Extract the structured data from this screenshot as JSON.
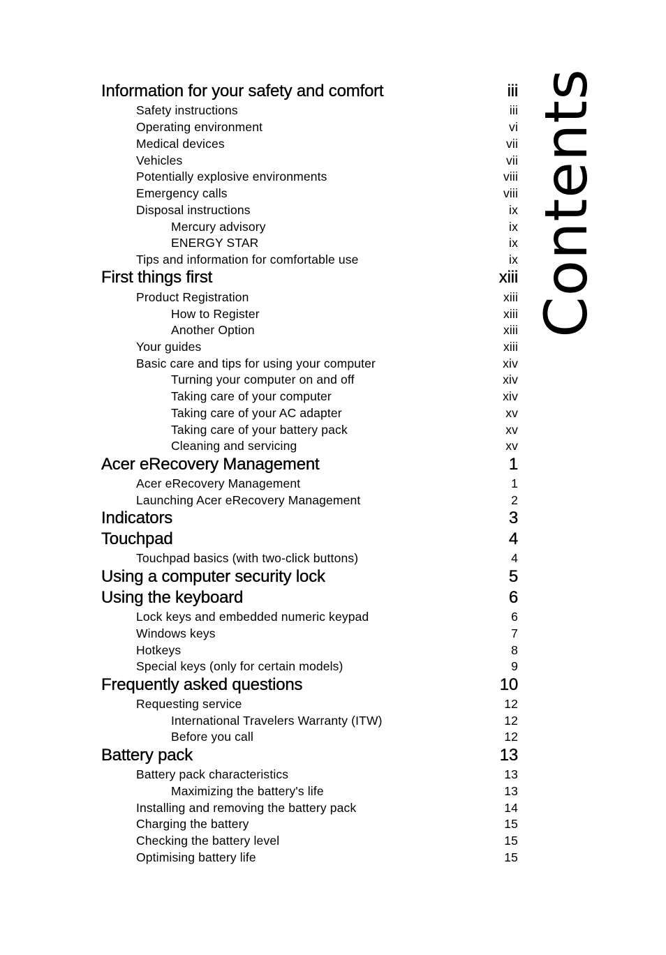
{
  "page": {
    "side_title": "Contents"
  },
  "toc": [
    {
      "level": 1,
      "title": "Information for your safety and comfort",
      "page": "iii"
    },
    {
      "level": 2,
      "title": "Safety instructions",
      "page": "iii"
    },
    {
      "level": 2,
      "title": "Operating environment",
      "page": "vi"
    },
    {
      "level": 2,
      "title": "Medical devices",
      "page": "vii"
    },
    {
      "level": 2,
      "title": "Vehicles",
      "page": "vii"
    },
    {
      "level": 2,
      "title": "Potentially explosive environments",
      "page": "viii"
    },
    {
      "level": 2,
      "title": "Emergency calls",
      "page": "viii"
    },
    {
      "level": 2,
      "title": "Disposal instructions",
      "page": "ix"
    },
    {
      "level": 3,
      "title": "Mercury advisory",
      "page": "ix"
    },
    {
      "level": 3,
      "title": "ENERGY STAR",
      "page": "ix"
    },
    {
      "level": 2,
      "title": "Tips and information for comfortable use",
      "page": "ix"
    },
    {
      "level": 1,
      "title": "First things first",
      "page": "xiii"
    },
    {
      "level": 2,
      "title": "Product Registration",
      "page": "xiii"
    },
    {
      "level": 3,
      "title": "How to Register",
      "page": "xiii"
    },
    {
      "level": 3,
      "title": "Another Option",
      "page": "xiii"
    },
    {
      "level": 2,
      "title": "Your guides",
      "page": "xiii"
    },
    {
      "level": 2,
      "title": "Basic care and tips for using your computer",
      "page": "xiv"
    },
    {
      "level": 3,
      "title": "Turning your computer on and off",
      "page": "xiv"
    },
    {
      "level": 3,
      "title": "Taking care of your computer",
      "page": "xiv"
    },
    {
      "level": 3,
      "title": "Taking care of your AC adapter",
      "page": "xv"
    },
    {
      "level": 3,
      "title": "Taking care of your battery pack",
      "page": "xv"
    },
    {
      "level": 3,
      "title": "Cleaning and servicing",
      "page": "xv"
    },
    {
      "level": 1,
      "title": "Acer eRecovery Management",
      "page": "1"
    },
    {
      "level": 2,
      "title": "Acer eRecovery Management",
      "page": "1"
    },
    {
      "level": 2,
      "title": "Launching Acer eRecovery Management",
      "page": "2"
    },
    {
      "level": 1,
      "title": "Indicators",
      "page": "3"
    },
    {
      "level": 1,
      "title": "Touchpad",
      "page": "4"
    },
    {
      "level": 2,
      "title": "Touchpad basics (with two-click buttons)",
      "page": "4"
    },
    {
      "level": 1,
      "title": "Using a computer security lock",
      "page": "5"
    },
    {
      "level": 1,
      "title": "Using the keyboard",
      "page": "6"
    },
    {
      "level": 2,
      "title": "Lock keys and embedded numeric keypad",
      "page": "6"
    },
    {
      "level": 2,
      "title": "Windows keys",
      "page": "7"
    },
    {
      "level": 2,
      "title": "Hotkeys",
      "page": "8"
    },
    {
      "level": 2,
      "title": "Special keys (only for certain models)",
      "page": "9"
    },
    {
      "level": 1,
      "title": "Frequently asked questions",
      "page": "10"
    },
    {
      "level": 2,
      "title": "Requesting service",
      "page": "12"
    },
    {
      "level": 3,
      "title": "International Travelers Warranty (ITW)",
      "page": "12"
    },
    {
      "level": 3,
      "title": "Before you call",
      "page": "12"
    },
    {
      "level": 1,
      "title": "Battery pack",
      "page": "13"
    },
    {
      "level": 2,
      "title": "Battery pack characteristics",
      "page": "13"
    },
    {
      "level": 3,
      "title": "Maximizing the battery's life",
      "page": "13"
    },
    {
      "level": 2,
      "title": "Installing and removing the battery pack",
      "page": "14"
    },
    {
      "level": 2,
      "title": "Charging the battery",
      "page": "15"
    },
    {
      "level": 2,
      "title": "Checking the battery level",
      "page": "15"
    },
    {
      "level": 2,
      "title": "Optimising battery life",
      "page": "15"
    }
  ]
}
